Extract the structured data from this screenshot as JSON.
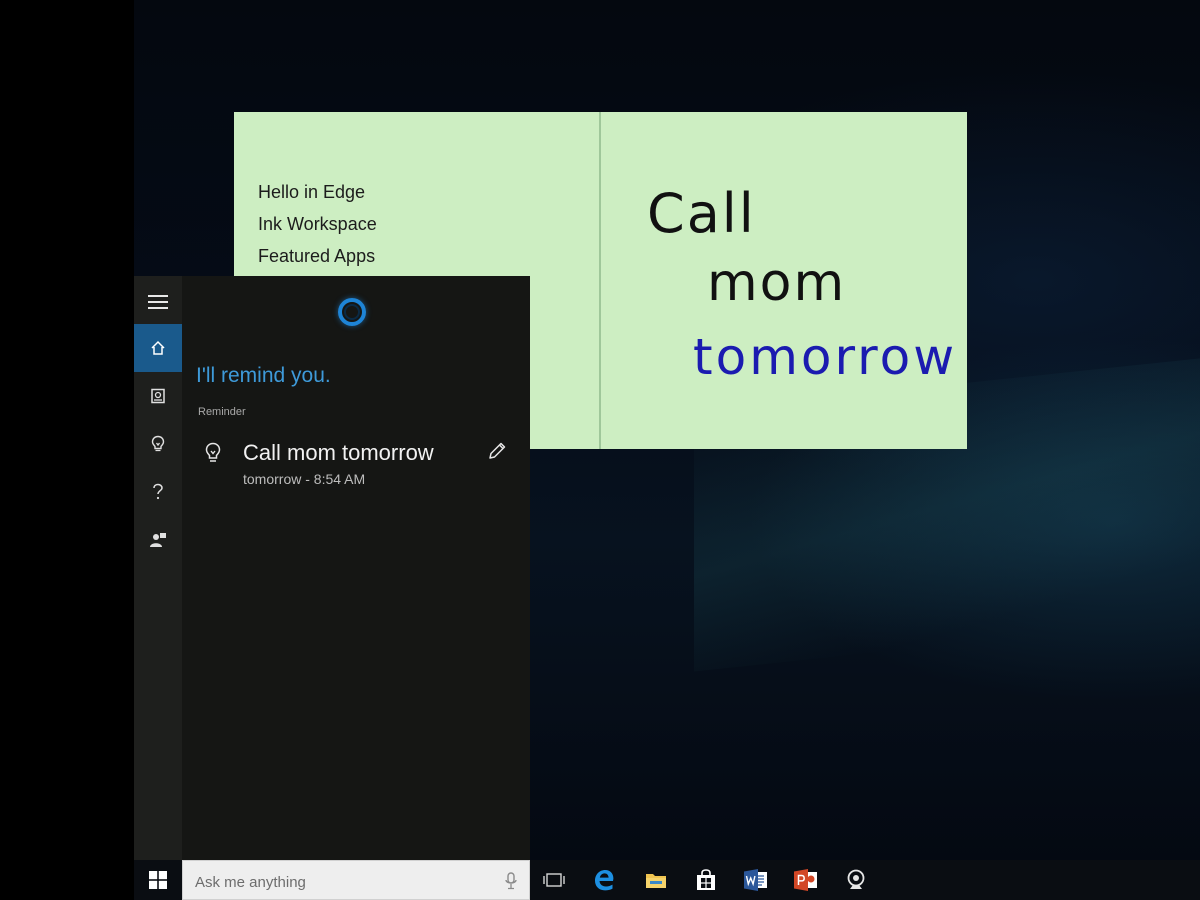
{
  "sticky_note": {
    "list_items": [
      "Hello in Edge",
      "Ink Workspace",
      "Featured Apps"
    ],
    "ink_lines": [
      "Call",
      "mom",
      "tomorrow"
    ],
    "colors": {
      "background": "#cdeec2",
      "ink_black": "#111111",
      "ink_blue": "#1b1bb0"
    }
  },
  "cortana": {
    "heading": "I'll remind you.",
    "section_label": "Reminder",
    "reminder": {
      "title": "Call mom tomorrow",
      "time": "tomorrow - 8:54 AM",
      "icon": "lightbulb-icon"
    },
    "rail_icons": [
      "hamburger-menu-icon",
      "home-icon",
      "notebook-icon",
      "lightbulb-icon",
      "help-icon",
      "feedback-icon"
    ],
    "accent_color": "#3e9ad9"
  },
  "taskbar": {
    "search_placeholder": "Ask me anything",
    "apps": [
      "task-view-icon",
      "edge-icon",
      "file-explorer-icon",
      "store-icon",
      "word-icon",
      "powerpoint-icon",
      "webcam-icon"
    ]
  }
}
